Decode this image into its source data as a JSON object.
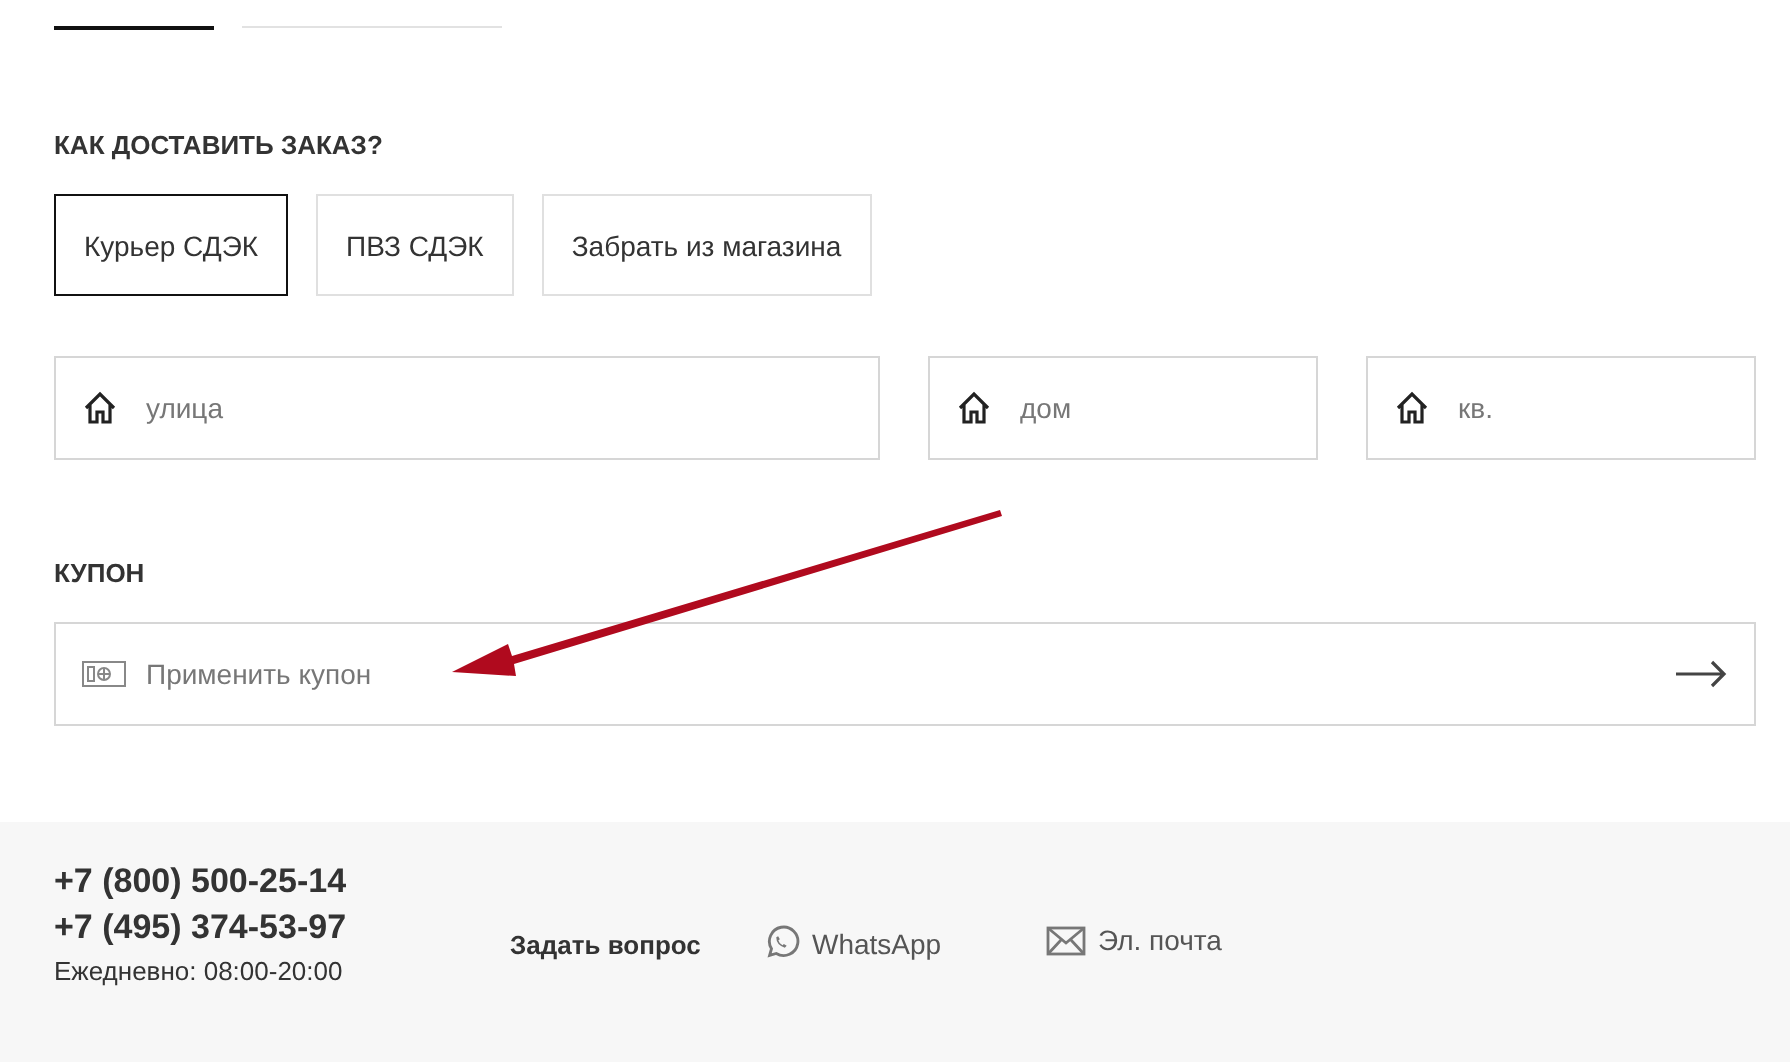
{
  "top_tabs": [
    {
      "selected": true
    },
    {
      "selected": false
    }
  ],
  "delivery": {
    "heading": "КАК ДОСТАВИТЬ ЗАКАЗ?",
    "options": [
      {
        "label": "Курьер СДЭК",
        "selected": true
      },
      {
        "label": "ПВЗ СДЭК",
        "selected": false
      },
      {
        "label": "Забрать из магазина",
        "selected": false
      }
    ],
    "fields": [
      {
        "placeholder": "улица"
      },
      {
        "placeholder": "дом"
      },
      {
        "placeholder": "кв."
      }
    ]
  },
  "coupon": {
    "heading": "КУПОН",
    "placeholder": "Применить купон"
  },
  "annotation": {
    "kind": "arrow"
  },
  "footer": {
    "phones": [
      "+7 (800) 500-25-14",
      "+7 (495) 374-53-97"
    ],
    "hours": "Ежедневно: 08:00-20:00",
    "ask": "Задать вопрос",
    "links": [
      {
        "kind": "whatsapp",
        "label": "WhatsApp"
      },
      {
        "kind": "email",
        "label": "Эл. почта"
      }
    ]
  }
}
